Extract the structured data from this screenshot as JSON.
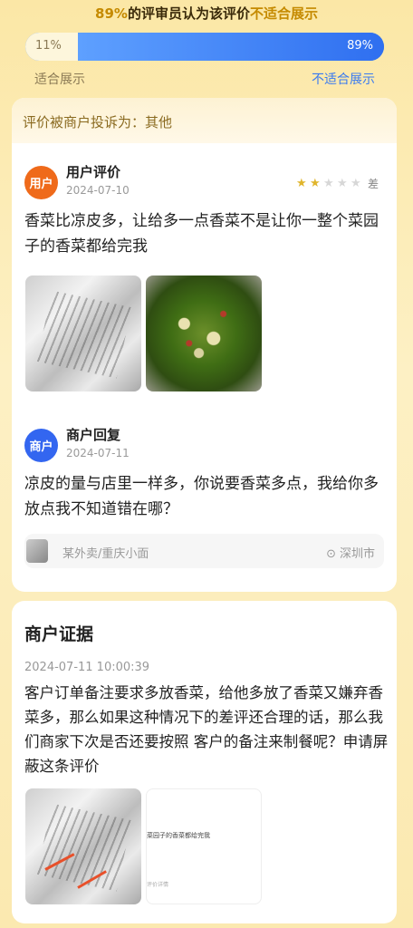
{
  "summary": {
    "percent": "89%",
    "text_mid": "的评审员认为该评价",
    "text_hl": "不适合展示"
  },
  "vote_bar": {
    "suitable_pct": "11%",
    "unsuitable_pct": "89%",
    "suitable_fraction": 0.11,
    "unsuitable_fraction": 0.89,
    "suitable_label": "适合展示",
    "unsuitable_label": "不适合展示"
  },
  "complaint": {
    "text": "评价被商户投诉为：其他"
  },
  "user_review": {
    "avatar_text": "用户",
    "name": "用户评价",
    "date": "2024-07-10",
    "rating": 2,
    "rating_max": 5,
    "rating_label": "差",
    "text": "香菜比凉皮多，让给多一点香菜不是让你一整个菜园子的香菜都给完我",
    "photos": [
      "receipt-photo",
      "salad-photo"
    ]
  },
  "merchant_reply": {
    "avatar_text": "商户",
    "name": "商户回复",
    "date": "2024-07-11",
    "text": "凉皮的量与店里一样多，你说要香菜多点，我给你多放点我不知道错在哪？"
  },
  "store": {
    "name": "某外卖/重庆小面",
    "city": "深圳市"
  },
  "evidence": {
    "title": "商户证据",
    "time": "2024-07-11 10:00:39",
    "text": "客户订单备注要求多放香菜，给他多放了香菜又嫌弃香菜多，那么如果这种情况下的差评还合理的话，那么我们商家下次是否还要按照 客户的备注来制餐呢？申请屏蔽这条评价",
    "thumb2_line1": "菜园子的香菜都给完我",
    "thumb2_line2": "评价详情"
  },
  "colors": {
    "accent_blue": "#2f7cf6",
    "accent_orange": "#ef6a1a",
    "gold": "#c58a00"
  }
}
